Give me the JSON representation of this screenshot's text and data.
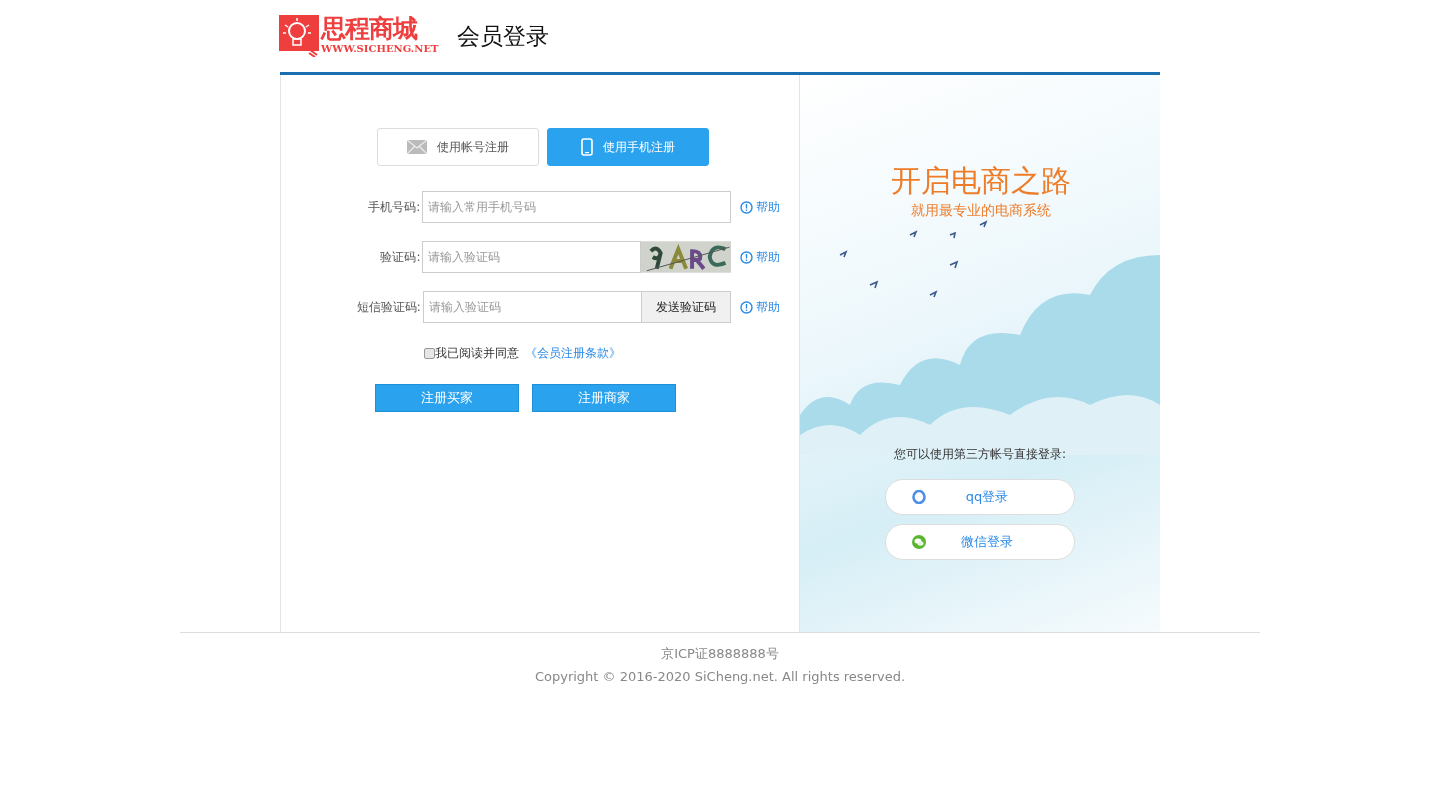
{
  "header": {
    "logo_name": "思程商城",
    "logo_url": "WWW.SICHENG.NET",
    "title": "会员登录"
  },
  "tabs": [
    {
      "label": "使用帐号注册",
      "kind": "mail",
      "selected": false
    },
    {
      "label": "使用手机注册",
      "kind": "phone",
      "selected": true
    }
  ],
  "fields": [
    {
      "kind": "plain",
      "label": "手机号码:",
      "placeholder": "请输入常用手机号码",
      "help": "帮助"
    },
    {
      "kind": "captcha",
      "label": "验证码:",
      "placeholder": "请输入验证码",
      "help": "帮助"
    },
    {
      "kind": "sms",
      "label": "短信验证码:",
      "placeholder": "请输入验证码",
      "button": "发送验证码",
      "help": "帮助"
    }
  ],
  "agreement": {
    "checked": false,
    "text": "我已阅读并同意",
    "link": "《会员注册条款》"
  },
  "buttons": [
    "注册买家",
    "注册商家"
  ],
  "banner": {
    "headline": "开启电商之路",
    "subline": "就用最专业的电商系统"
  },
  "third_party": {
    "prompt": "您可以使用第三方帐号直接登录:",
    "options": [
      {
        "kind": "qq",
        "label": "qq登录"
      },
      {
        "kind": "wechat",
        "label": "微信登录"
      }
    ]
  },
  "footer": {
    "icp": "京ICP证8888888号",
    "copyright": "Copyright © 2016-2020 SiCheng.net. All rights reserved."
  }
}
